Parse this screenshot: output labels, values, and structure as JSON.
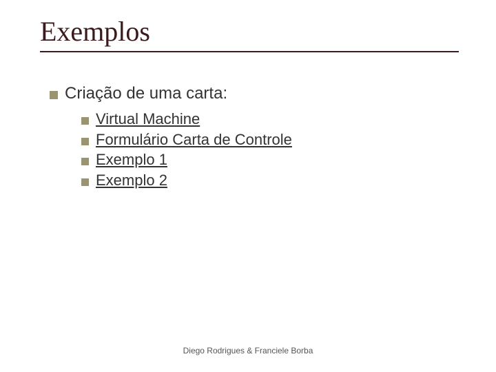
{
  "title": "Exemplos",
  "level1_text": "Criação de uma carta:",
  "subitems": {
    "0": "Virtual Machine",
    "1": "Formulário Carta de Controle",
    "2": "Exemplo 1",
    "3": "Exemplo 2"
  },
  "footer": "Diego Rodrigues & Franciele Borba"
}
